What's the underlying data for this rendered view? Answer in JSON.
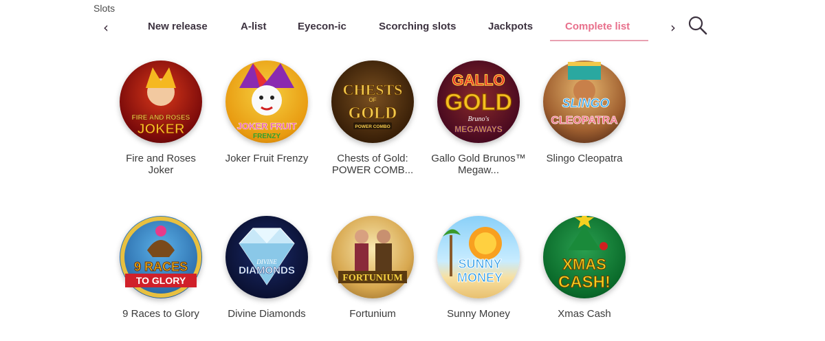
{
  "section": {
    "label": "Slots"
  },
  "tabs": [
    {
      "label": "New release"
    },
    {
      "label": "A-list"
    },
    {
      "label": "Eyecon-ic"
    },
    {
      "label": "Scorching slots"
    },
    {
      "label": "Jackpots"
    },
    {
      "label": "Complete list",
      "active": true
    }
  ],
  "colors": {
    "accent": "#e8708c",
    "tab_text": "#3d3340"
  },
  "icons": {
    "prev": "chevron-left-icon",
    "next": "chevron-right-icon",
    "search": "search-icon"
  },
  "games": [
    {
      "name_line1": "Fire and Roses",
      "name_line2": "Joker",
      "art": [
        "FIRE AND ROSES",
        "JOKER"
      ]
    },
    {
      "name_line1": "Joker Fruit Frenzy",
      "name_line2": "",
      "art": [
        "JOKER FRUIT",
        "FRENZY"
      ]
    },
    {
      "name_line1": "Chests of Gold:",
      "name_line2": "POWER COMB...",
      "art": [
        "CHESTS",
        "GOLD"
      ]
    },
    {
      "name_line1": "Gallo Gold Brunos™",
      "name_line2": "Megaw...",
      "art": [
        "GALLO",
        "GOLD"
      ]
    },
    {
      "name_line1": "Slingo Cleopatra",
      "name_line2": "",
      "art": [
        "SLINGO",
        "CLEOPATRA"
      ]
    },
    {
      "name_line1": "9 Races to Glory",
      "name_line2": "",
      "art": [
        "9 RACES",
        "TO GLORY"
      ]
    },
    {
      "name_line1": "Divine Diamonds",
      "name_line2": "",
      "art": [
        "DIVINE",
        "DIAMONDS"
      ]
    },
    {
      "name_line1": "Fortunium",
      "name_line2": "",
      "art": [
        "",
        "FORTUNIUM"
      ]
    },
    {
      "name_line1": "Sunny Money",
      "name_line2": "",
      "art": [
        "SUNNY",
        "MONEY"
      ]
    },
    {
      "name_line1": "Xmas Cash",
      "name_line2": "",
      "art": [
        "XMAS",
        "CASH!"
      ]
    }
  ]
}
